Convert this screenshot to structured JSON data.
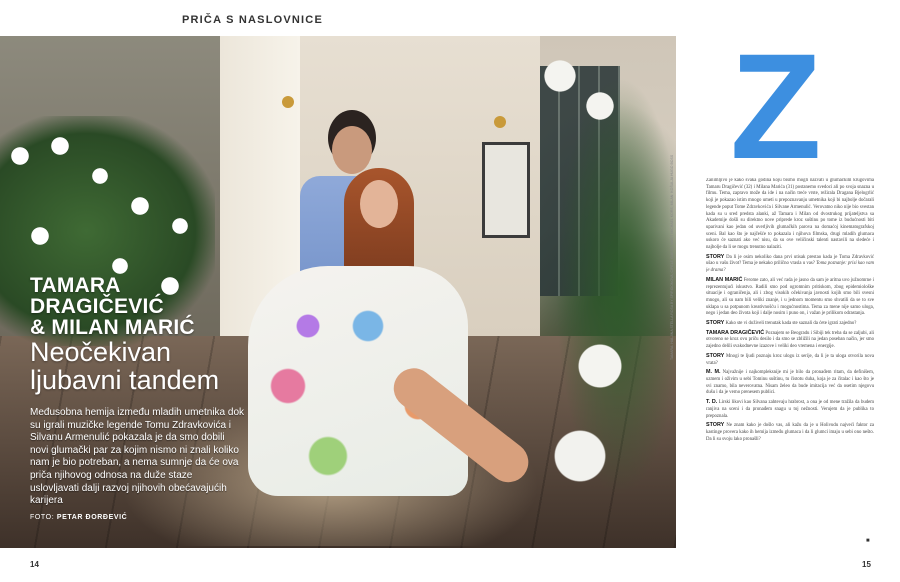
{
  "section_label": "PRIČA S NASLOVNICE",
  "names": [
    "TAMARA",
    "DRAGIČEVIĆ",
    "& MILAN MARIĆ"
  ],
  "headline": [
    "Neočekivan",
    "ljubavni tandem"
  ],
  "lead": "Međusobna hemija između mladih umetnika dok su igrali muzičke legende Tomu Zdravkovića i Silvanu Armenulić pokazala je da smo dobili novi glumački par za kojim nismo ni znali koliko nam je bio potreban, a nema sumnje da će ova priča njihovog odnosa na duže staze uslovljavati dalji razvoj njihovih obećavajućih karijera",
  "photo_credit_label": "FOTO:",
  "photo_credit_name": "PETAR ĐORĐEVIĆ",
  "vertical_credit": "TAMARA: HALJINA STELLA ROSA BY SPIRIDONOVA; CIPELE GUESS; NAKIT MICHAEL KORS; MILAN: KOŠULJA HUGO BOSS",
  "dropcap": "Z",
  "article": {
    "intro": "Zanimljivo je kako svaka godina koju bismo mogli nazvati u glumačkim krugovima Tamaru Dragičević (32) i Milana Marića (31) postanemo svedoci ali po svoja snazna u filmu. Tema, zapravo može da ide i na način treće vrste, režirala Dragana Bjelogrlić koji je pokazao istim mnogo umeti u prepoznavanju umetnika koji bi najbolje dočarali legende poput Tome Zdravkovića i Silvane Armenulić. Verovatno niko nije bio svestan kada su u sred predsta alanki, až Tamara i Milan od dvostrukog prijateljstva sa Akademije došli su direktno nove priprede kroz suštinu po tome iz budućnosti biti uparivani kao jedan od uverljivih glumačkih parova na domaćoj kinematografskoj sceni. Bal kao što je najčešće to pokazala i njihova filmska, drugi mladih glumaca uskoro će saznati ako već nisu, da su ove veličinski talenti nastavili na sledeće i najbolje da li se mogu trenutno nalaziti.",
    "q1_label": "STORY",
    "q1": "Da li je osim nekoliko dana prvi utisak prestao kada je Toma Zdravković ušao u vašu život? Tema je nekako prilično vrasla u vas?",
    "q1_italic": "Toma poznanje: prisi kao vam je drama?",
    "a1_label": "MILAN MARIĆ",
    "a1": "Ferome zato, ali već rada je jasno da sam je aritna uvo južnomrne i reprezentujući iskustvo. Radili smo pod ogromnim pritiskom, zbog epidemiološke situacije i ograničenja, ali i zbog visokih očekivanja javnosti kojih smo bili svesni mnogo, ali su nam bili veliki znanje, i u jednom momentu smo shvatili da se to sve uklapa u sa potpunom kreativnošću i mogućnostima. Tema za mene nije samo uloga, nego i jedan deo života koji i dalje nosim i puno on, i važan je prilikom odrastanja.",
    "q2_label": "STORY",
    "q2": "Kako ste vi doživeli trenutak kada ste saznali da ćete igrati zajedno?",
    "a2_label": "TAMARA DRAGIČEVIĆ",
    "a2": "Poznajem se Beogradu i Sibiji tek treba da se zaljubi, ali otvoreno se kroz ovu priču desilo i da smo se zbližili na jedan poseban način, jer smo zajedno delili svakodnevne izazove i veliki deo vremena i energije.",
    "q3_label": "STORY",
    "q3": "Mnogi te ljudi poznaju kroz ulogu iz serije, da li je ta uloga otvorila nova vrata?",
    "a3_label": "M. M.",
    "a3": "Najvažnije i najkompleksnije mi je bilo da pronađem ritam, da definišem, uzmem i oživim u sebi Tominu suštinu, tu čistotu duha, koja je za čitalac i kao što je svi znamo, bila neverovatna. Nisam želeo da bude imitacija već da osetim njegovu dušu i da je verno prenesem publici.",
    "a4_label": "T. D.",
    "a4": "Lirski likovi kao Silvana zahtevaju hrabrost, a ona je od mene tražila da budem ranjiva na sceni i da pronađem snagu u toj nežnosti. Verujem da je publika to prepoznala.",
    "q5_label": "STORY",
    "q5": "Ne znam kako je došlo vas, ali kažu da je u Holivudu najveći faktor za kastinge provera kako ih hemija između glumaca i da li glumci imaju u sebi ono nešto. Da li su svoju lako pronašli?"
  },
  "end_mark": "■",
  "page_left": "14",
  "page_right": "15",
  "colors": {
    "accent": "#3d8fe0",
    "text": "#444444"
  }
}
